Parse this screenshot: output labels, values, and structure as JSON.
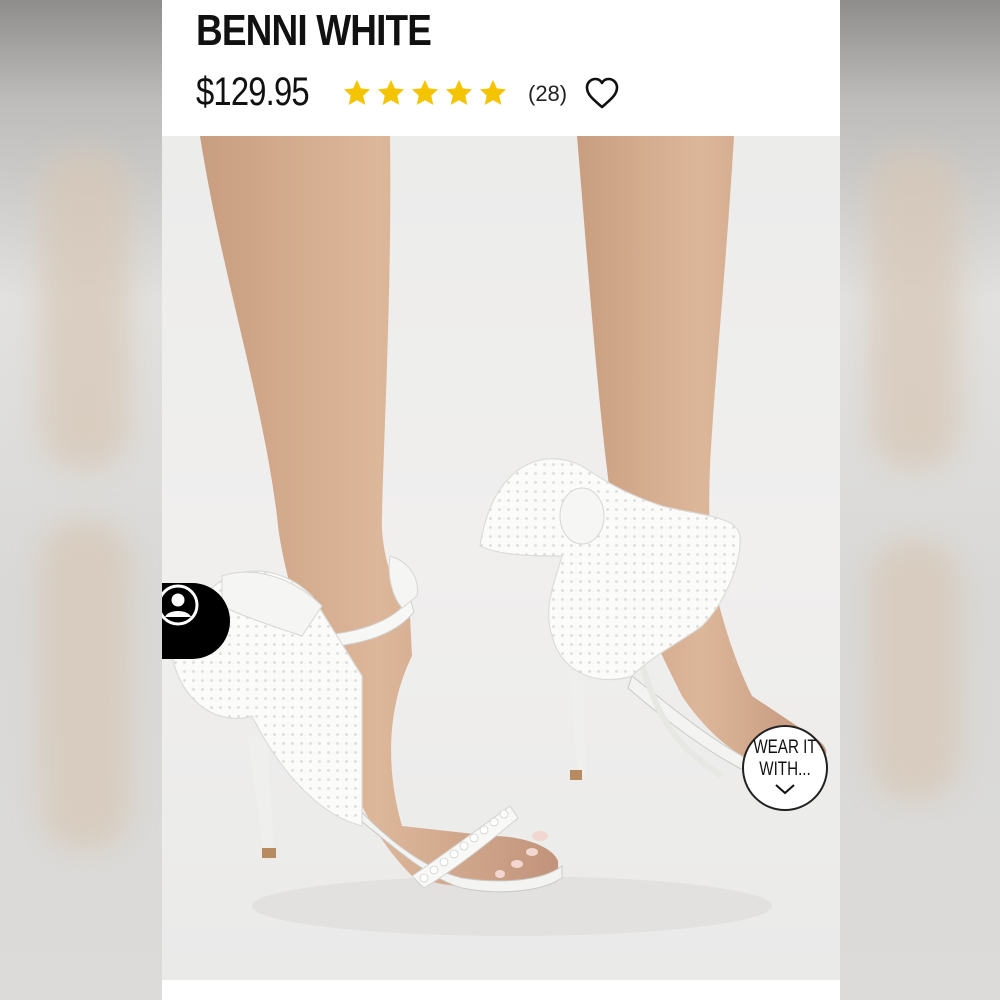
{
  "product": {
    "title": "BENNI WHITE",
    "price": "$129.95",
    "rating": 5,
    "rating_max": 5,
    "review_count": "(28)"
  },
  "icons": {
    "star": "star-icon",
    "favorite": "heart-outline-icon",
    "avatar": "user-circle-icon",
    "wear_chevron": "chevron-down-icon"
  },
  "wear_it_with": {
    "line1": "WEAR IT",
    "line2": "WITH..."
  },
  "colors": {
    "star": "#f5c400",
    "text": "#111111",
    "avatar_tab": "#000000"
  }
}
